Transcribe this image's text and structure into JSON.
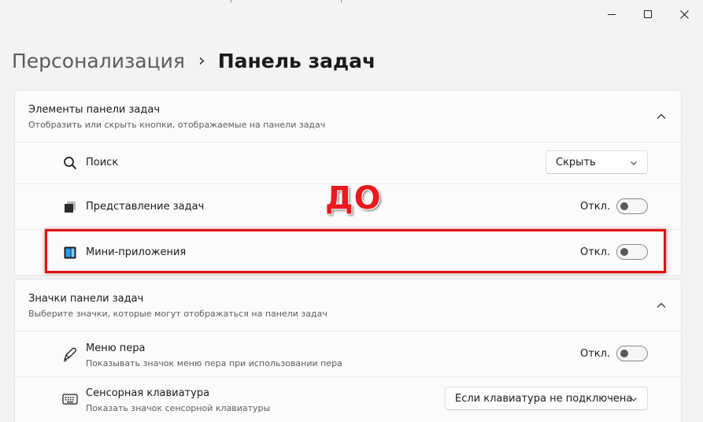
{
  "breadcrumb": {
    "parent": "Персонализация",
    "separator": "›",
    "current": "Панель задач"
  },
  "annotation": {
    "text": "ДО",
    "color": "#e8191f"
  },
  "taskbar_items": {
    "title": "Элементы панели задач",
    "subtitle": "Отобразить или скрыть кнопки, отображаемые на панели задач",
    "rows": [
      {
        "label": "Поиск",
        "icon": "search-icon",
        "control": "dropdown",
        "value": "Скрыть"
      },
      {
        "label": "Представление задач",
        "icon": "task-view-icon",
        "control": "toggle",
        "state_text": "Откл."
      },
      {
        "label": "Мини-приложения",
        "icon": "widgets-icon",
        "control": "toggle",
        "state_text": "Откл."
      }
    ]
  },
  "taskbar_icons": {
    "title": "Значки панели задач",
    "subtitle": "Выберите значки, которые могут отображаться на панели задач",
    "rows": [
      {
        "label": "Меню пера",
        "sub": "Показывать значок меню пера при использовании пера",
        "icon": "pen-icon",
        "control": "toggle",
        "state_text": "Откл."
      },
      {
        "label": "Сенсорная клавиатура",
        "sub": "Показать значок сенсорной клавиатуры",
        "icon": "keyboard-icon",
        "control": "dropdown",
        "value": "Если клавиатура не подключена"
      }
    ]
  },
  "colors": {
    "background": "#f3f3f3",
    "card": "#fbfbfb",
    "highlight": "#e01212",
    "widgets_icon": "#0f6cbd"
  }
}
